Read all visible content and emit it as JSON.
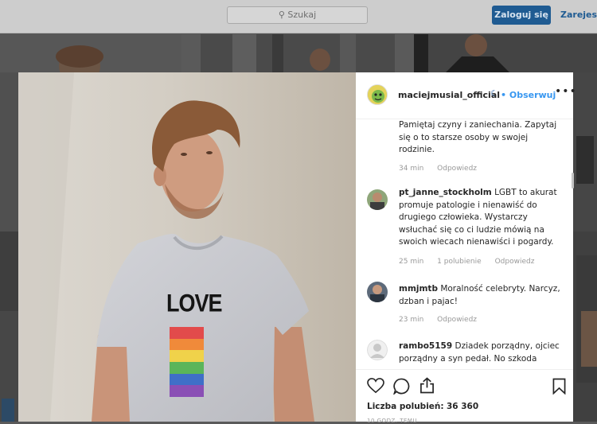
{
  "header": {
    "search_placeholder": "Szukaj",
    "login_label": "Zaloguj się",
    "register_label": "Zarejestruj"
  },
  "post": {
    "username": "maciejmusial_official",
    "follow_label": "• Obserwuj",
    "shirt_text": "LOVE",
    "likes_label": "Liczba polubień:",
    "likes_count": "36 360",
    "time_ago": "10 GODZ. TEMU"
  },
  "comments": [
    {
      "username": "",
      "text": "Pamiętaj czyny i zaniechania. Zapytaj się o to starsze osoby w swojej rodzinie.",
      "time": "34 min",
      "likes": "",
      "reply": "Odpowiedz"
    },
    {
      "username": "pt_janne_stockholm",
      "text": "LGBT to akurat promuje patologie i nienawiść do drugiego człowieka. Wystarczy wsłuchać się co ci ludzie mówią na swoich wiecach nienawiści i pogardy.",
      "time": "25 min",
      "likes": "1 polubienie",
      "reply": "Odpowiedz"
    },
    {
      "username": "mmjmtb",
      "text": "Moralność celebryty. Narcyz, dzban i pajac!",
      "time": "23 min",
      "likes": "",
      "reply": "Odpowiedz"
    },
    {
      "username": "rambo5159",
      "text": "Dziadek porządny, ojciec porządny a syn pedał. No szkoda",
      "time": "",
      "likes": "",
      "reply": ""
    }
  ],
  "colors": {
    "accent": "#3897f0",
    "login_bg": "#1f5b92",
    "rainbow": [
      "#e24b4b",
      "#f08a3a",
      "#f0d24a",
      "#5bb55a",
      "#3f6fc8",
      "#8a4fb5"
    ]
  }
}
